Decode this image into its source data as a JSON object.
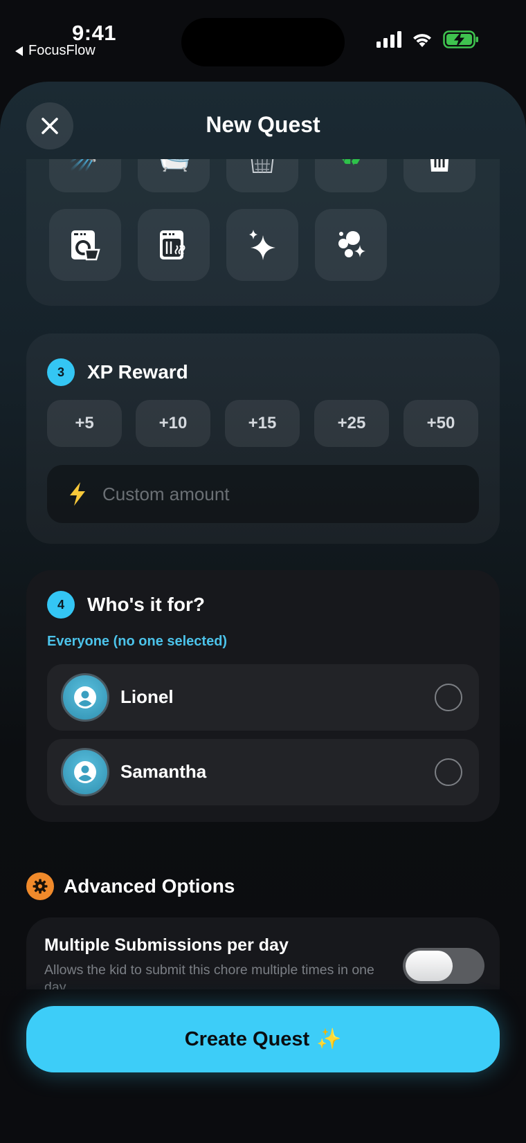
{
  "status_bar": {
    "time": "9:41",
    "back_app": "FocusFlow"
  },
  "header": {
    "title": "New Quest",
    "close_icon": "close-icon"
  },
  "icon_picker": {
    "row1": [
      "shower-icon",
      "bathtub-icon",
      "wastebasket-icon",
      "recycle-icon",
      "trash-can-icon"
    ],
    "row2": [
      "washing-machine-icon",
      "dishwasher-icon",
      "sparkles-icon",
      "bubbles-icon"
    ]
  },
  "xp_reward": {
    "step": "3",
    "title": "XP Reward",
    "options": [
      "+5",
      "+10",
      "+15",
      "+25",
      "+50"
    ],
    "custom_placeholder": "Custom amount"
  },
  "who_for": {
    "step": "4",
    "title": "Who's it for?",
    "subtitle": "Everyone (no one selected)",
    "people": [
      {
        "name": "Lionel"
      },
      {
        "name": "Samantha"
      }
    ]
  },
  "advanced": {
    "title": "Advanced Options",
    "multi_title": "Multiple Submissions per day",
    "multi_desc": "Allows the kid to submit this chore multiple times in one day",
    "multi_enabled": false
  },
  "footer": {
    "create_label": "Create Quest",
    "create_emoji": "✨"
  },
  "colors": {
    "accent": "#3dcdf8",
    "step_badge": "#34c6f4",
    "advanced_badge": "#f08a2b",
    "subtitle": "#4cc3ea"
  }
}
